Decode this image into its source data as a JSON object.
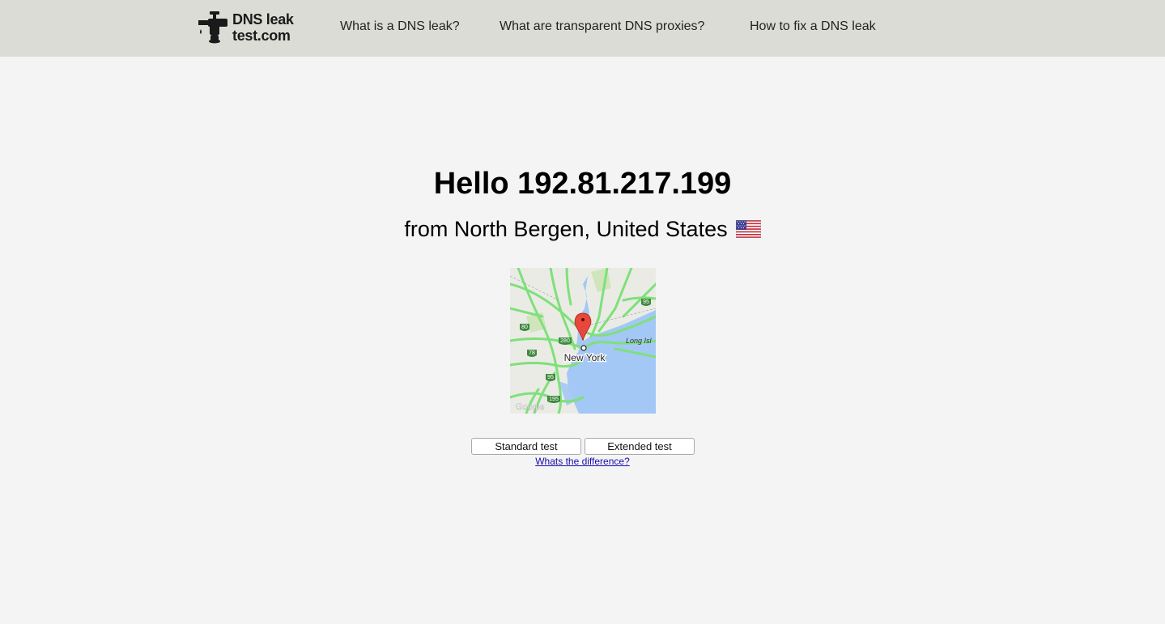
{
  "header": {
    "logo_line1": "DNS leak",
    "logo_line2": "test.com",
    "nav": [
      {
        "label": "What is a DNS leak?"
      },
      {
        "label": "What are transparent DNS proxies?"
      },
      {
        "label": "How to fix a DNS leak"
      }
    ],
    "background_color": "#dcdcd6"
  },
  "main": {
    "greeting": "Hello 192.81.217.199",
    "location": "from North Bergen, United States",
    "flag_icon": "us-flag-icon",
    "map": {
      "city_label": "New York",
      "region_label": "Long Isl",
      "highway_shields": [
        "95",
        "80",
        "280",
        "78",
        "95",
        "195"
      ],
      "attribution": "Google"
    },
    "buttons": {
      "standard": "Standard test",
      "extended": "Extended test"
    },
    "difference_link": "Whats the difference?"
  },
  "colors": {
    "page_background": "#f4f4f4",
    "link": "#1a0dab",
    "map_water": "#a3c8f5",
    "map_roads": "#7fe07a",
    "map_land": "#ebebe6",
    "marker": "#e9473b"
  }
}
